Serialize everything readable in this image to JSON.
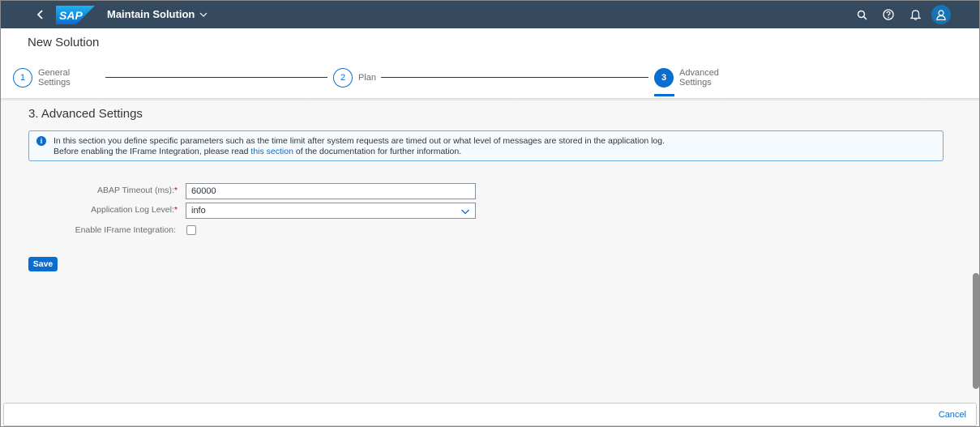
{
  "shell": {
    "logo_text": "SAP",
    "app_title": "Maintain Solution"
  },
  "header": {
    "page_title": "New Solution",
    "steps": [
      {
        "number": "1",
        "label_line1": "General",
        "label_line2": "Settings",
        "active": false
      },
      {
        "number": "2",
        "label_line1": "Plan",
        "label_line2": "",
        "active": false
      },
      {
        "number": "3",
        "label_line1": "Advanced",
        "label_line2": "Settings",
        "active": true
      }
    ]
  },
  "content": {
    "section_title": "3. Advanced Settings",
    "info": {
      "line1": "In this section you define specific parameters such as the time limit after system requests are timed out or what level of messages are stored in the application log.",
      "line2_before": "Before enabling the IFrame Integration, please read ",
      "line2_link": "this section",
      "line2_after": " of the documentation for further information."
    },
    "form": {
      "abap_timeout_label": "ABAP Timeout (ms):",
      "abap_timeout_value": "60000",
      "log_level_label": "Application Log Level:",
      "log_level_value": "info",
      "iframe_label": "Enable IFrame Integration:",
      "iframe_checked": false
    },
    "save_label": "Save"
  },
  "footer": {
    "cancel_label": "Cancel"
  },
  "colors": {
    "shell_bg": "#354a5f",
    "brand_blue": "#0a6ed1",
    "required_red": "#bb0000"
  }
}
